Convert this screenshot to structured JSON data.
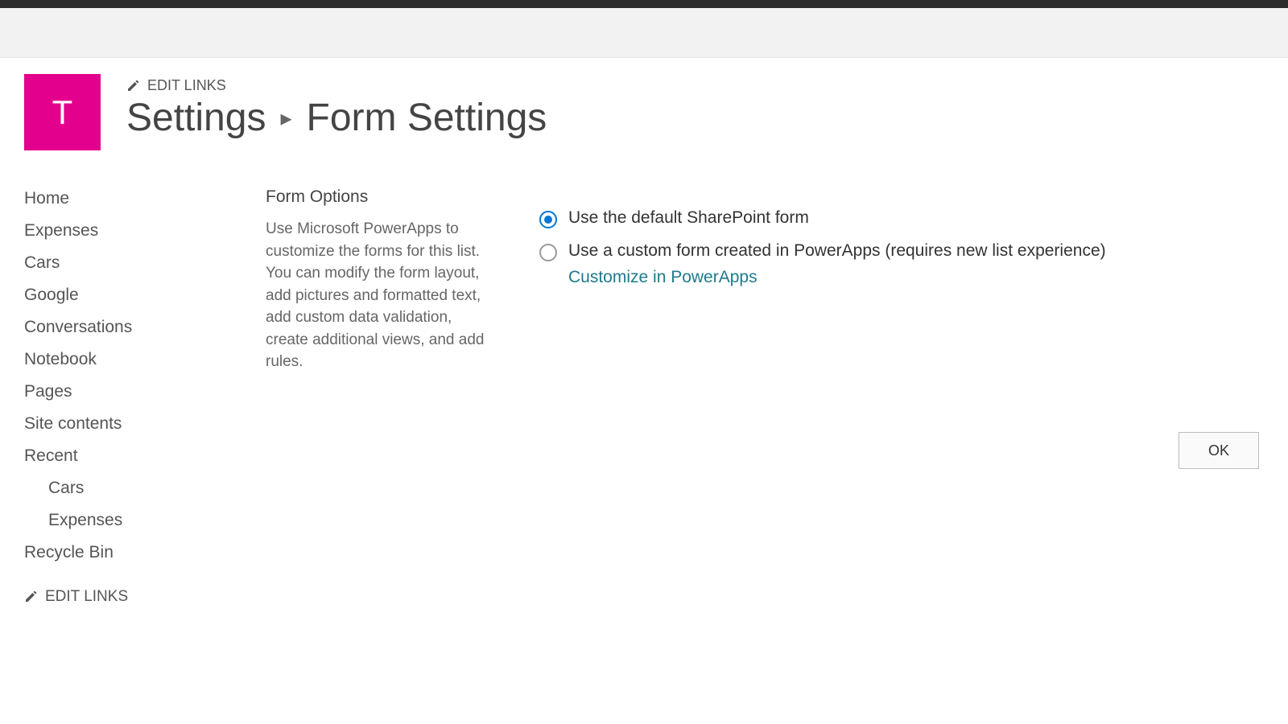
{
  "site": {
    "logo_letter": "T",
    "edit_links_label": "EDIT LINKS"
  },
  "breadcrumb": {
    "parent": "Settings",
    "current": "Form Settings"
  },
  "sidebar": {
    "items": [
      "Home",
      "Expenses",
      "Cars",
      "Google",
      "Conversations",
      "Notebook",
      "Pages",
      "Site contents"
    ],
    "recent_label": "Recent",
    "recent_items": [
      "Cars",
      "Expenses"
    ],
    "recycle_bin": "Recycle Bin",
    "edit_links_label": "EDIT LINKS"
  },
  "form_options": {
    "heading": "Form Options",
    "description": "Use Microsoft PowerApps to customize the forms for this list. You can modify the form layout, add pictures and formatted text, add custom data validation, create additional views, and add rules.",
    "option_default": "Use the default SharePoint form",
    "option_custom": "Use a custom form created in PowerApps (requires new list experience)",
    "customize_link": "Customize in PowerApps",
    "selected": "default"
  },
  "buttons": {
    "ok": "OK"
  }
}
